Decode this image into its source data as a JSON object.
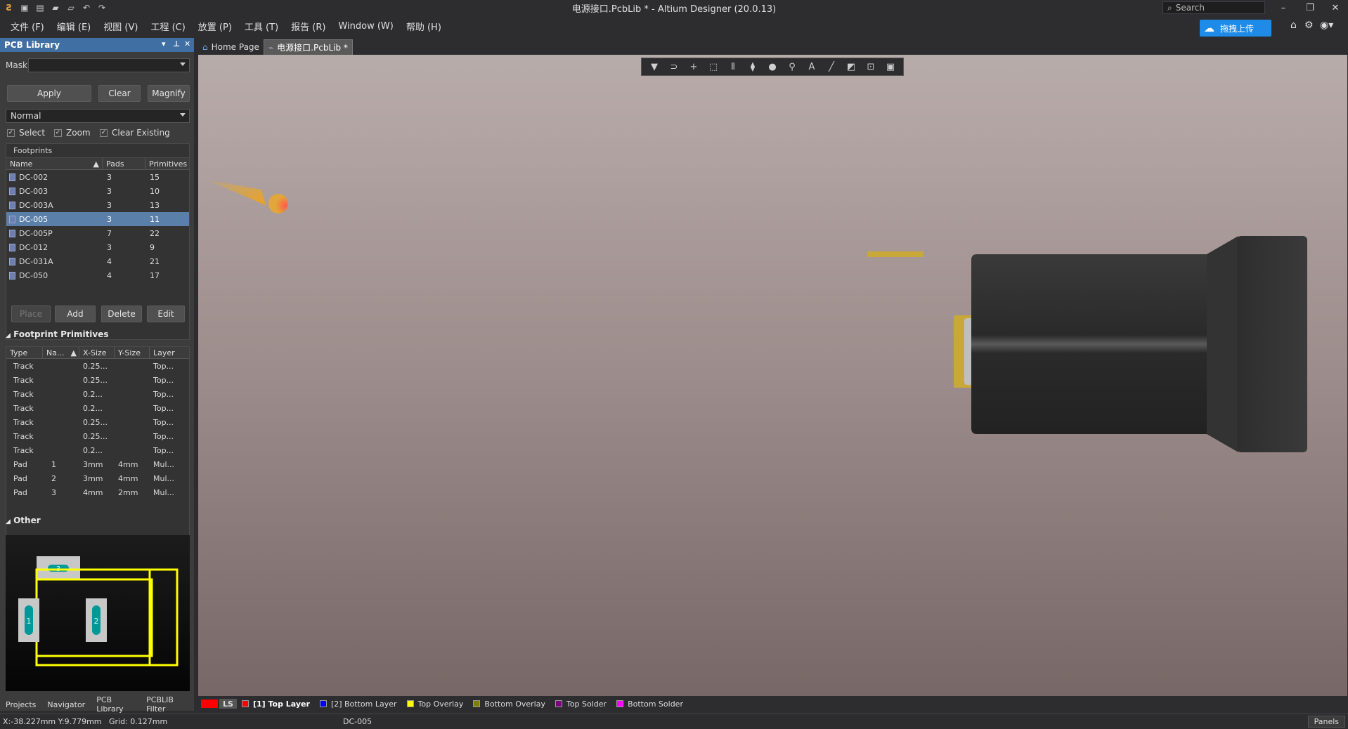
{
  "window": {
    "title": "电源接口.PcbLib * - Altium Designer (20.0.13)",
    "search_placeholder": "Search",
    "upload_label": "拖拽上传"
  },
  "menu": [
    "文件 (F)",
    "编辑 (E)",
    "视图 (V)",
    "工程 (C)",
    "放置 (P)",
    "工具 (T)",
    "报告 (R)",
    "Window (W)",
    "帮助 (H)"
  ],
  "panel": {
    "title": "PCB Library",
    "mask_label": "Mask",
    "mask_value": "",
    "buttons": {
      "apply": "Apply",
      "clear": "Clear",
      "magnify": "Magnify"
    },
    "mode": "Normal",
    "checks": {
      "select": "Select",
      "zoom": "Zoom",
      "clear_existing": "Clear Existing"
    },
    "footprints_title": "Footprints",
    "footprint_columns": [
      "Name",
      "Pads",
      "Primitives"
    ],
    "footprints": [
      {
        "name": "DC-002",
        "pads": "3",
        "primitives": "15"
      },
      {
        "name": "DC-003",
        "pads": "3",
        "primitives": "10"
      },
      {
        "name": "DC-003A",
        "pads": "3",
        "primitives": "13"
      },
      {
        "name": "DC-005",
        "pads": "3",
        "primitives": "11"
      },
      {
        "name": "DC-005P",
        "pads": "7",
        "primitives": "22"
      },
      {
        "name": "DC-012",
        "pads": "3",
        "primitives": "9"
      },
      {
        "name": "DC-031A",
        "pads": "4",
        "primitives": "21"
      },
      {
        "name": "DC-050",
        "pads": "4",
        "primitives": "17"
      }
    ],
    "footprint_buttons": {
      "place": "Place",
      "add": "Add",
      "delete": "Delete",
      "edit": "Edit"
    },
    "primitives_title": "Footprint Primitives",
    "primitive_columns": [
      "Type",
      "Na...",
      "X-Size",
      "Y-Size",
      "Layer"
    ],
    "primitives": [
      {
        "type": "Track",
        "name": "",
        "x": "0.25...",
        "y": "",
        "layer": "Top..."
      },
      {
        "type": "Track",
        "name": "",
        "x": "0.25...",
        "y": "",
        "layer": "Top..."
      },
      {
        "type": "Track",
        "name": "",
        "x": "0.2...",
        "y": "",
        "layer": "Top..."
      },
      {
        "type": "Track",
        "name": "",
        "x": "0.2...",
        "y": "",
        "layer": "Top..."
      },
      {
        "type": "Track",
        "name": "",
        "x": "0.25...",
        "y": "",
        "layer": "Top..."
      },
      {
        "type": "Track",
        "name": "",
        "x": "0.25...",
        "y": "",
        "layer": "Top..."
      },
      {
        "type": "Track",
        "name": "",
        "x": "0.2...",
        "y": "",
        "layer": "Top..."
      },
      {
        "type": "Pad",
        "name": "1",
        "x": "3mm",
        "y": "4mm",
        "layer": "Mul..."
      },
      {
        "type": "Pad",
        "name": "2",
        "x": "3mm",
        "y": "4mm",
        "layer": "Mul..."
      },
      {
        "type": "Pad",
        "name": "3",
        "x": "4mm",
        "y": "2mm",
        "layer": "Mul..."
      }
    ],
    "other_title": "Other",
    "preview_pads": [
      "1",
      "2",
      "3"
    ],
    "tabs": [
      "Projects",
      "Navigator",
      "PCB Library",
      "PCBLIB Filter"
    ]
  },
  "doc_tabs": [
    {
      "label": "Home Page",
      "active": false
    },
    {
      "label": "电源接口.PcbLib *",
      "active": true
    }
  ],
  "layers": {
    "ls_label": "LS",
    "items": [
      {
        "label": "[1] Top Layer",
        "color": "#ff0000",
        "active": true
      },
      {
        "label": "[2] Bottom Layer",
        "color": "#0000ff",
        "active": false
      },
      {
        "label": "Top Overlay",
        "color": "#ffff00",
        "active": false
      },
      {
        "label": "Bottom Overlay",
        "color": "#808000",
        "active": false
      },
      {
        "label": "Top Solder",
        "color": "#800080",
        "active": false
      },
      {
        "label": "Bottom Solder",
        "color": "#ff00ff",
        "active": false
      }
    ]
  },
  "status": {
    "coords": "X:-38.227mm Y:9.779mm",
    "grid": "Grid: 0.127mm",
    "component": "DC-005",
    "panels": "Panels"
  },
  "colors": {
    "accent": "#3f6fa3",
    "selection": "#5a7fa8",
    "overlay": "#ffff00",
    "pad": "#009999",
    "upload": "#1f8be8"
  }
}
